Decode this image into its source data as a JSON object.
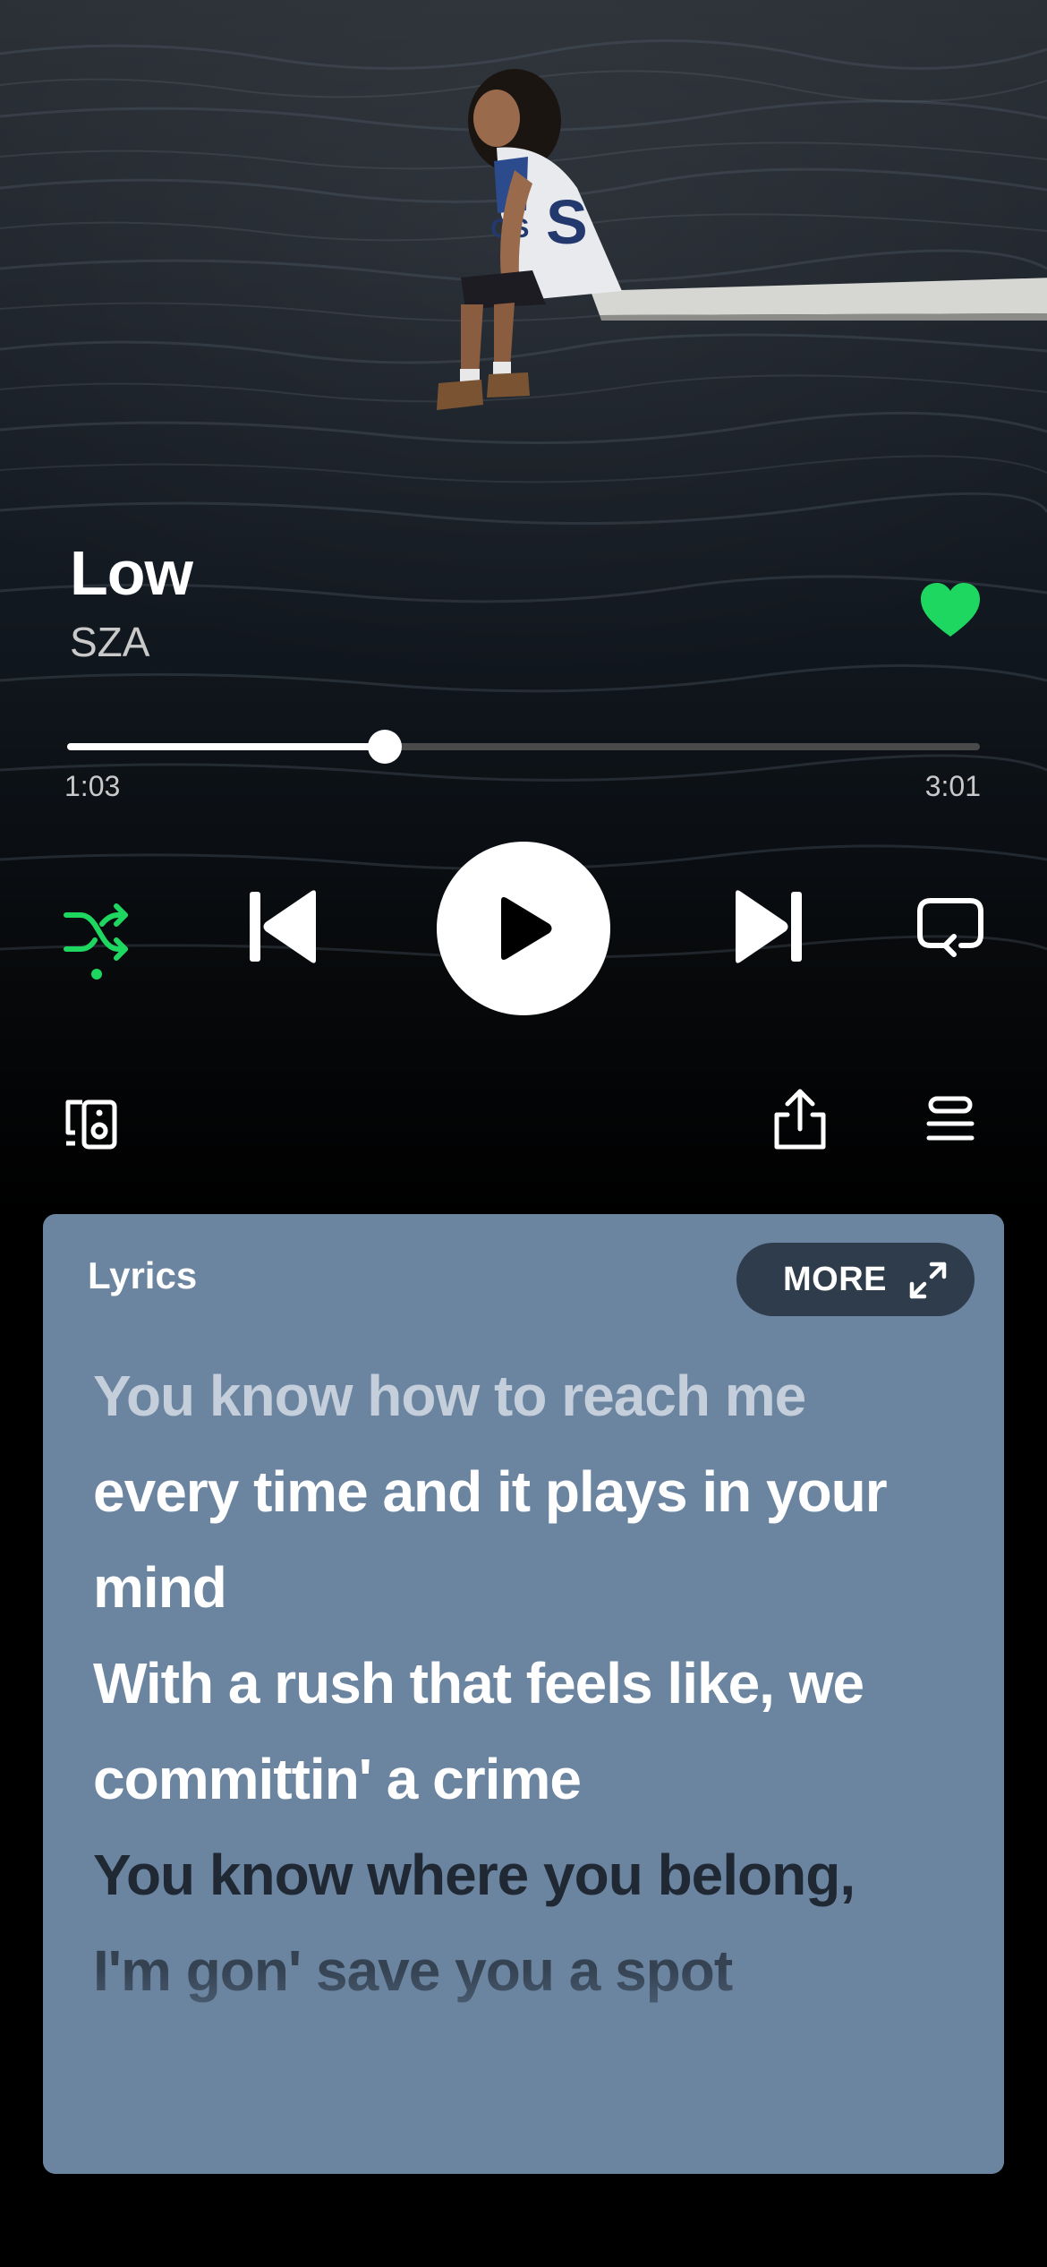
{
  "track": {
    "title": "Low",
    "artist": "SZA",
    "liked": true
  },
  "progress": {
    "elapsed": "1:03",
    "total": "3:01",
    "fraction": 0.348
  },
  "controls": {
    "shuffle_active": true,
    "accent_color": "#1ed760",
    "icons": [
      "shuffle-icon",
      "previous-icon",
      "play-icon",
      "next-icon",
      "repeat-icon",
      "devices-icon",
      "share-icon",
      "queue-icon"
    ]
  },
  "lyrics": {
    "label": "Lyrics",
    "more_label": "MORE",
    "card_color": "#6b84a0",
    "lines": [
      {
        "text": "You know how to reach me",
        "state": "past"
      },
      {
        "text": "every time and it plays in your",
        "state": "current"
      },
      {
        "text": "mind",
        "state": "current"
      },
      {
        "text": "With a rush that feels like, we",
        "state": "current"
      },
      {
        "text": "committin' a crime",
        "state": "current"
      },
      {
        "text": "You know where you belong,",
        "state": "future"
      },
      {
        "text": "I'm gon' save you a spot",
        "state": "future-dim"
      }
    ]
  }
}
